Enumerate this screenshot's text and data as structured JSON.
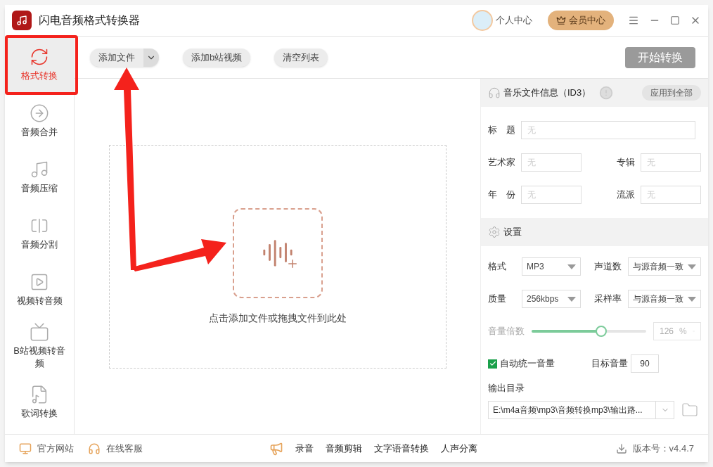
{
  "window": {
    "title": "闪电音频格式转换器",
    "user_center": "个人中心",
    "vip_button": "会员中心"
  },
  "sidebar": {
    "items": [
      {
        "kind": "convert",
        "label": "格式转换",
        "selected": true
      },
      {
        "kind": "merge",
        "label": "音频合并",
        "selected": false
      },
      {
        "kind": "compress",
        "label": "音频压缩",
        "selected": false
      },
      {
        "kind": "split",
        "label": "音频分割",
        "selected": false
      },
      {
        "kind": "video",
        "label": "视频转音频",
        "selected": false
      },
      {
        "kind": "bilibili",
        "label": "B站视频转音频",
        "selected": false
      },
      {
        "kind": "lyrics",
        "label": "歌词转换",
        "selected": false
      }
    ]
  },
  "toolbar": {
    "add_file": "添加文件",
    "add_bilibili": "添加b站视频",
    "clear_list": "清空列表",
    "start": "开始转换"
  },
  "drop_zone": {
    "hint": "点击添加文件或拖拽文件到此处"
  },
  "id3": {
    "title": "音乐文件信息（ID3）",
    "apply_all": "应用到全部",
    "fields": [
      {
        "label": "标　题",
        "placeholder": "无"
      },
      {
        "label": "艺术家",
        "placeholder": "无"
      },
      {
        "label": "专辑",
        "placeholder": "无"
      },
      {
        "label": "年　份",
        "placeholder": "无"
      },
      {
        "label": "流派",
        "placeholder": "无"
      }
    ]
  },
  "settings": {
    "title": "设置",
    "selects": [
      {
        "label": "格式",
        "value": "MP3"
      },
      {
        "label": "声道数",
        "value": "与源音频一致"
      },
      {
        "label": "质量",
        "value": "256kbps"
      },
      {
        "label": "采样率",
        "value": "与源音频一致"
      }
    ],
    "volume": {
      "label": "音量倍数",
      "level": 0.61,
      "reading": "126",
      "unit": "%",
      "disabled": true
    },
    "auto_volume": {
      "label": "自动统一音量",
      "checked": true
    },
    "target_volume": {
      "label": "目标音量",
      "value": "90"
    },
    "output": {
      "label": "输出目录",
      "value": "E:\\m4a音频\\mp3\\音频转换mp3\\输出路..."
    }
  },
  "footer": {
    "website": "官方网站",
    "support": "在线客服",
    "tools": [
      "录音",
      "音频剪辑",
      "文字语音转换",
      "人声分离"
    ],
    "version": "版本号：v4.4.7"
  }
}
